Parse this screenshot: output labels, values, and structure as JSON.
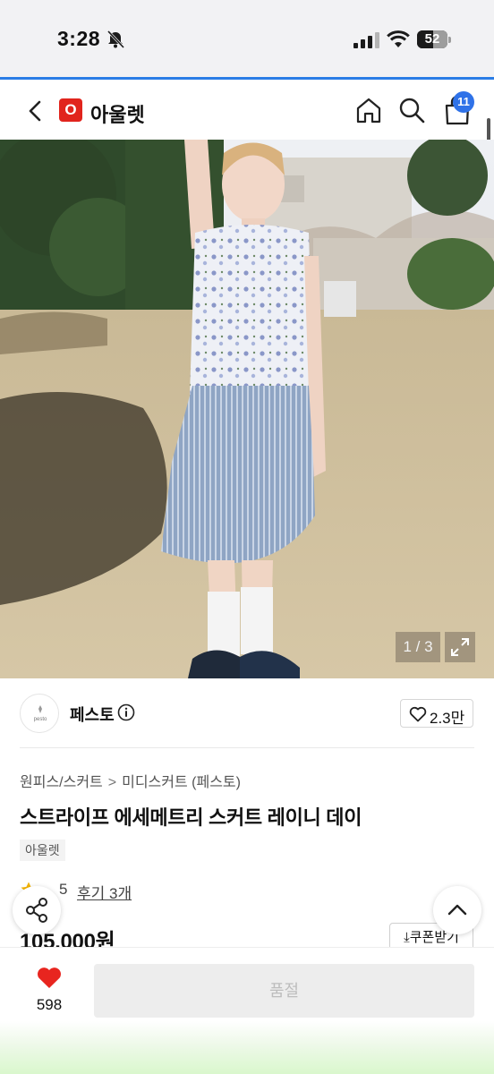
{
  "status_bar": {
    "time": "3:28",
    "battery_level": "52"
  },
  "header": {
    "brand_logo_letter": "O",
    "brand_name": "아울렛",
    "cart_count": "11"
  },
  "photo": {
    "counter": "1 / 3"
  },
  "store": {
    "avatar_text": "pesto",
    "name": "페스토",
    "likes": "2.3만"
  },
  "product": {
    "breadcrumb": [
      "원피스/스커트",
      "미디스커트 (페스토)"
    ],
    "breadcrumb_separator": ">",
    "title": "스트라이프 에세메트리 스커트 레이니 데이",
    "tag": "아울렛",
    "rating": "5",
    "review_link": "후기 3개",
    "price": "105,000원",
    "coupon": "쿠폰받기"
  },
  "bottom_bar": {
    "wish_count": "598",
    "soldout_label": "품절"
  },
  "icons": {
    "muted": "bell-off-icon",
    "back": "chevron-left-icon",
    "home": "home-icon",
    "search": "search-icon",
    "cart": "shopping-bag-icon",
    "expand": "expand-icon",
    "info": "info-icon",
    "like": "heart-outline-icon",
    "star": "star-icon",
    "share": "share-icon",
    "top": "chevron-up-icon",
    "wish": "heart-filled-icon"
  },
  "colors": {
    "accent": "#2f72e8",
    "brand": "#e1241d",
    "wish": "#e8251f"
  }
}
